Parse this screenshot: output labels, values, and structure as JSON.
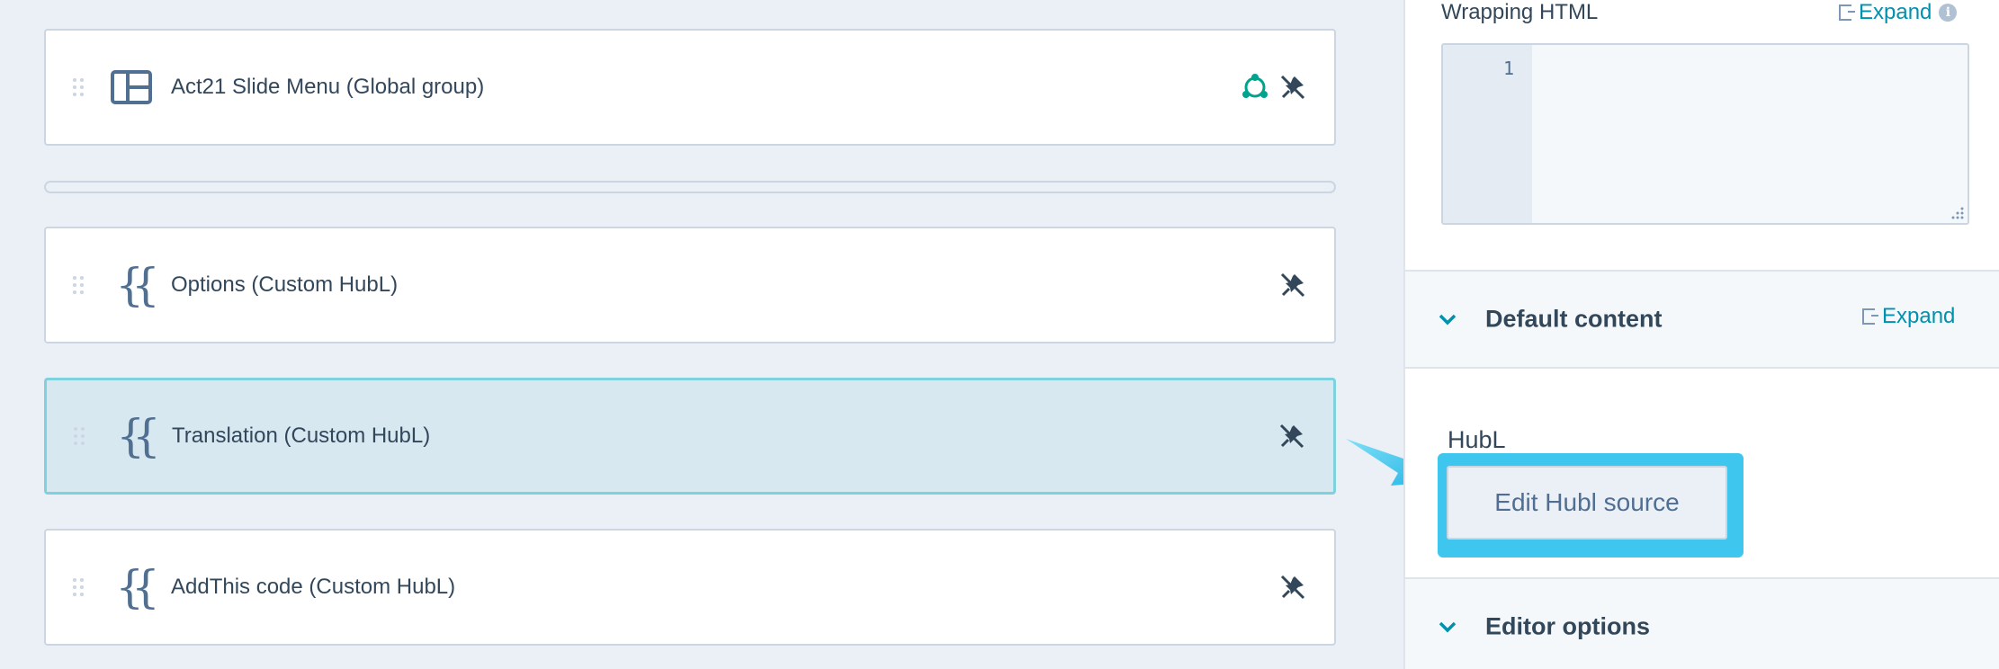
{
  "modules": [
    {
      "label": "Act21 Slide Menu (Global group)",
      "icon": "layout-icon",
      "actions": [
        "global-content-icon",
        "pin-off-icon"
      ]
    },
    {
      "label": "Options (Custom HubL)",
      "icon": "braces-icon",
      "actions": [
        "pin-off-icon"
      ]
    },
    {
      "label": "Translation (Custom HubL)",
      "icon": "braces-icon",
      "actions": [
        "pin-off-icon"
      ],
      "selected": true
    },
    {
      "label": "AddThis code (Custom HubL)",
      "icon": "braces-icon",
      "actions": [
        "pin-off-icon"
      ]
    }
  ],
  "sidebar": {
    "wrapping_html_label": "Wrapping HTML",
    "expand_label": "Expand",
    "info_glyph": "i",
    "code_line_number": "1",
    "default_content": {
      "title": "Default content",
      "expand_label": "Expand"
    },
    "hubl_label": "HubL",
    "edit_button_label": "Edit Hubl source",
    "editor_options": {
      "title": "Editor options"
    }
  },
  "colors": {
    "accent": "#0091ae",
    "highlight": "#3fc6ef",
    "selected_row": "#d7e8f1",
    "selected_border": "#7fd1de",
    "canvas": "#eaf0f6"
  }
}
